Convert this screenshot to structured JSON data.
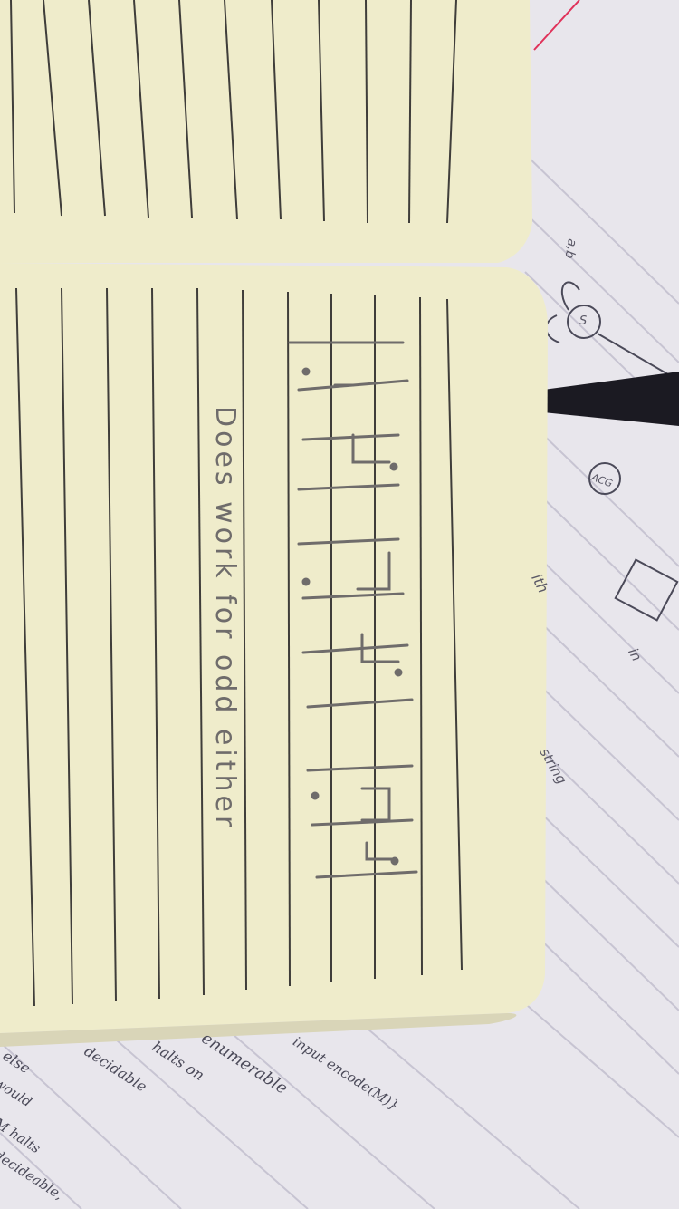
{
  "scene": {
    "background_notes": {
      "lines": [
        "ith",
        "string",
        "ACG",
        "in"
      ],
      "state_label": "S",
      "loop_label": "a,b",
      "bottom": [
        "enumerable",
        "input encode(M)}",
        "halts on",
        "decidable",
        "else",
        "would",
        "M halts",
        "decideable,"
      ]
    },
    "notebook": {
      "handwritten_caption": "Does    work   for   odd   either"
    },
    "colors": {
      "paper_cream": "#efeccb",
      "paper_shadow": "#d9d5b8",
      "ink": "#7a7774",
      "bg_paper": "#e9e7ec",
      "red_margin": "#e0325a"
    }
  }
}
